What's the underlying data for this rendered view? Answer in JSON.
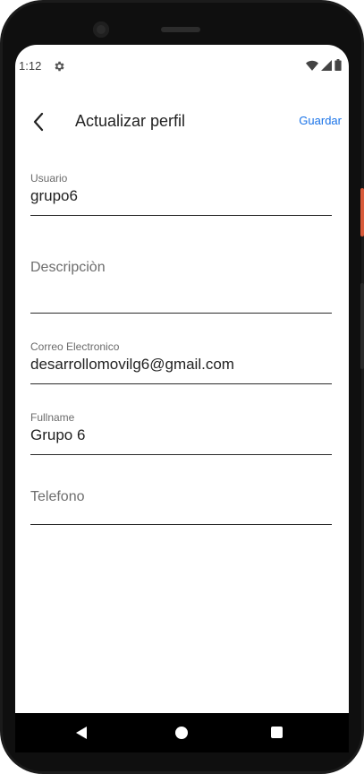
{
  "status_bar": {
    "time": "1:12"
  },
  "app_bar": {
    "title": "Actualizar perfil",
    "save_label": "Guardar"
  },
  "form": {
    "usuario": {
      "label": "Usuario",
      "value": "grupo6"
    },
    "descripcion": {
      "placeholder": "Descripciòn",
      "value": ""
    },
    "correo": {
      "label": "Correo Electronico",
      "value": "desarrollomovilg6@gmail.com"
    },
    "fullname": {
      "label": "Fullname",
      "value": "Grupo 6"
    },
    "telefono": {
      "placeholder": "Telefono",
      "value": ""
    }
  },
  "colors": {
    "accent": "#1a73e8",
    "underline": "#2a2a2a",
    "frame": "#1b1b1b"
  },
  "icons": {
    "status": [
      "gear-icon",
      "wifi-icon",
      "signal-icon",
      "battery-icon"
    ],
    "app_bar": [
      "back-arrow-icon"
    ],
    "nav": [
      "nav-back-icon",
      "nav-home-icon",
      "nav-recent-icon"
    ]
  }
}
